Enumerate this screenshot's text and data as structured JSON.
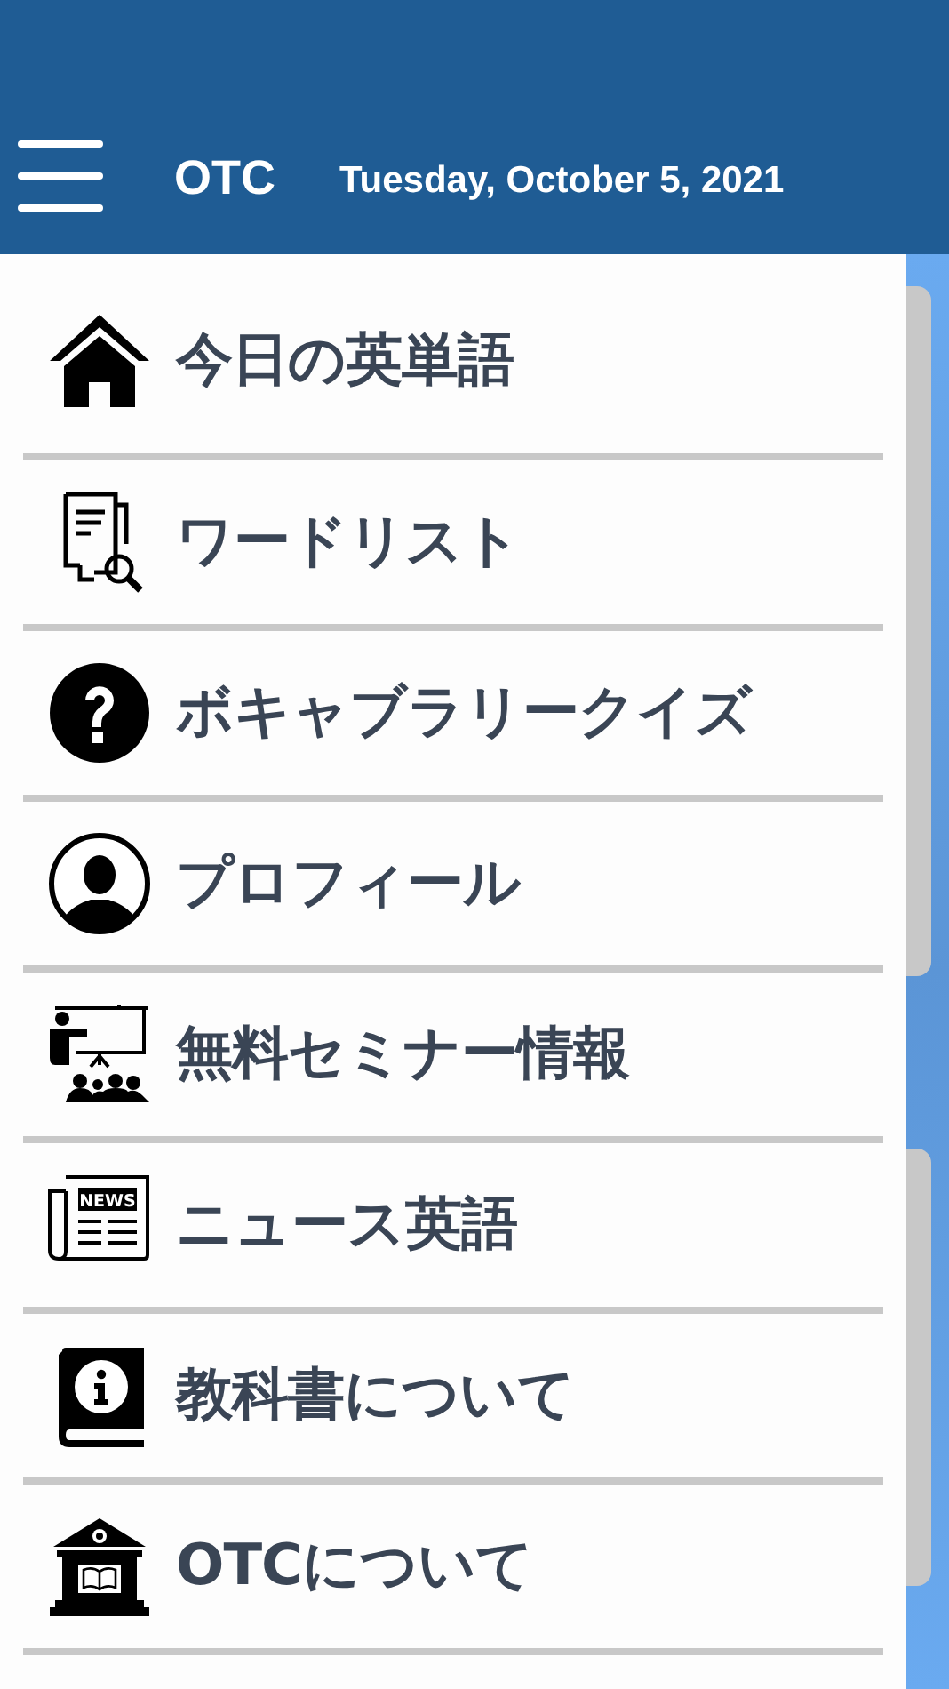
{
  "header": {
    "title": "OTC",
    "date": "Tuesday, October 5, 2021"
  },
  "menu": [
    {
      "kind": "home",
      "label": "今日の英単語"
    },
    {
      "kind": "wordlist",
      "label": "ワードリスト"
    },
    {
      "kind": "quiz",
      "label": "ボキャブラリークイズ"
    },
    {
      "kind": "profile",
      "label": "プロフィール"
    },
    {
      "kind": "seminar",
      "label": "無料セミナー情報"
    },
    {
      "kind": "news",
      "label": "ニュース英語",
      "icon_text": "NEWS"
    },
    {
      "kind": "textbook",
      "label": "教科書について"
    },
    {
      "kind": "school",
      "label": "OTCについて"
    }
  ]
}
